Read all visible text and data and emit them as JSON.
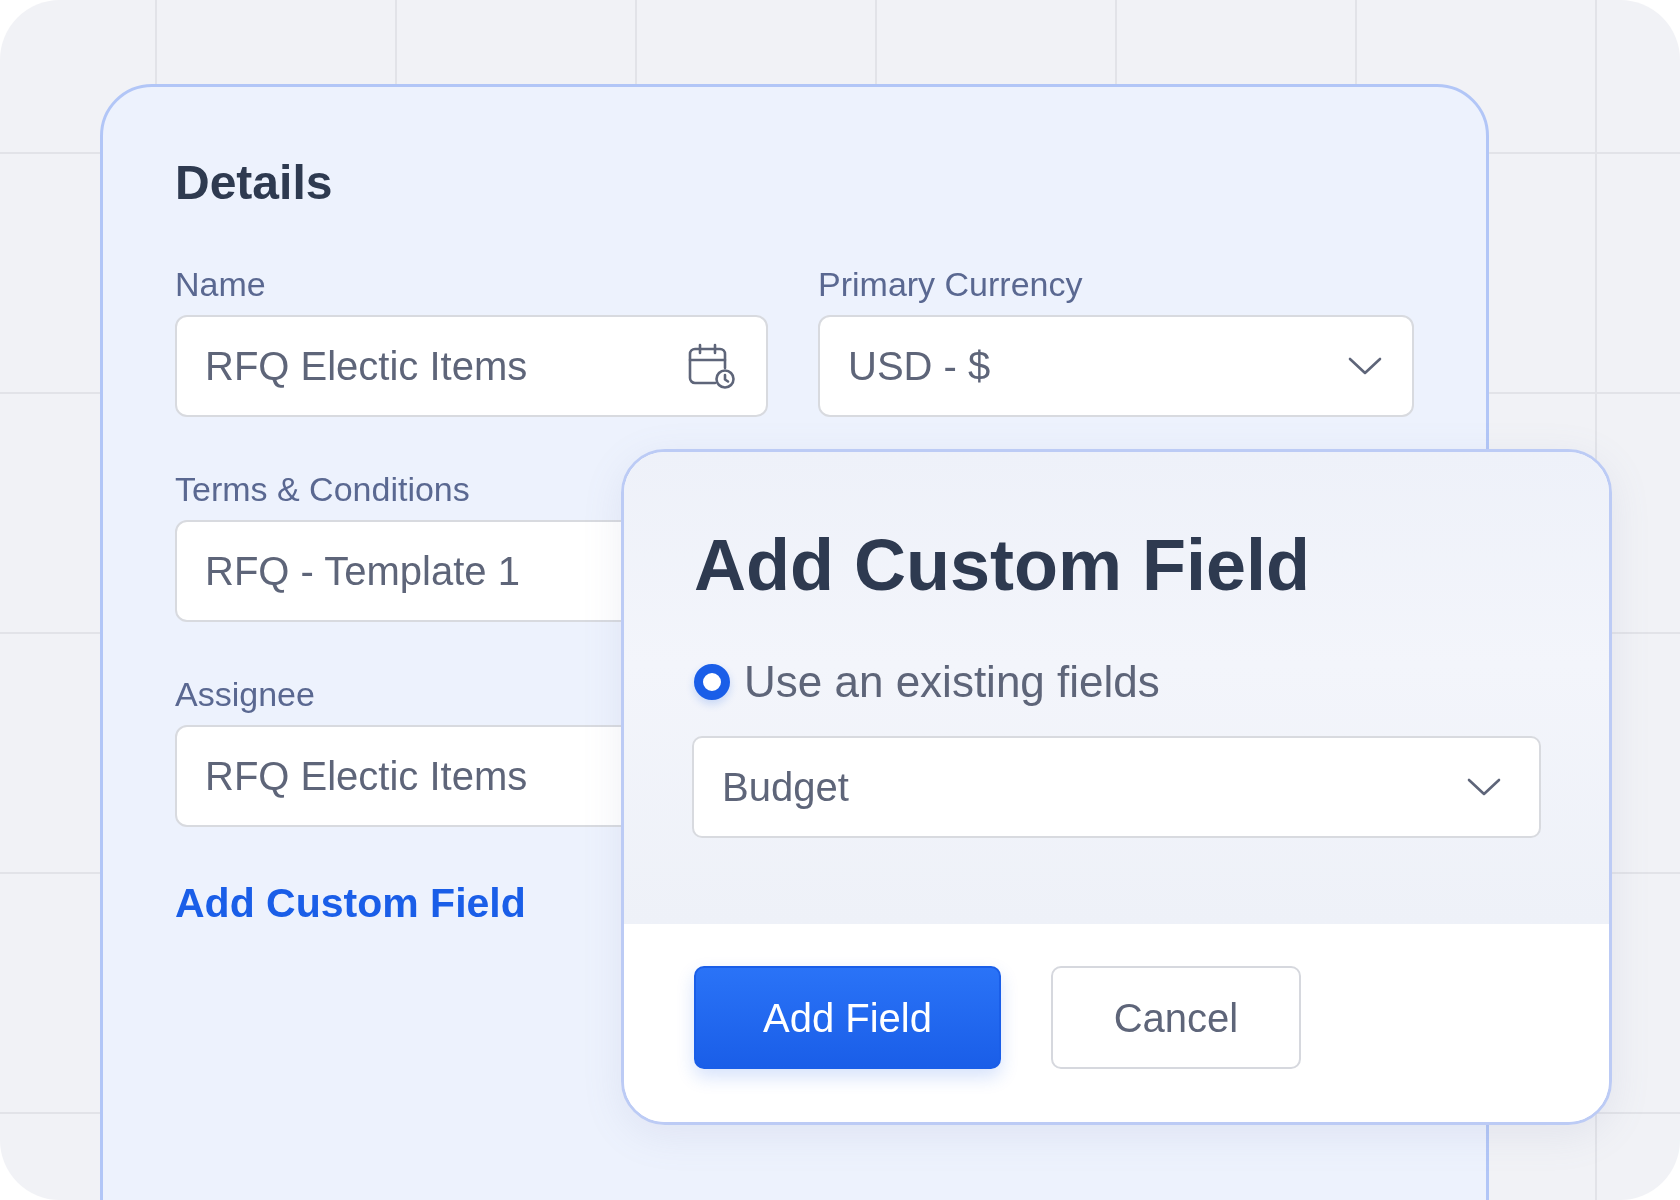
{
  "details": {
    "title": "Details",
    "fields": [
      {
        "label": "Name",
        "value": "RFQ Electic Items",
        "kind": "date"
      },
      {
        "label": "Primary Currency",
        "value": "USD - $",
        "kind": "select"
      },
      {
        "label": "Terms & Conditions",
        "value": "RFQ - Template 1",
        "kind": "text"
      },
      {
        "label": "Assignee",
        "value": "RFQ Electic Items",
        "kind": "text"
      }
    ],
    "add_link": "Add Custom Field"
  },
  "dialog": {
    "title": "Add Custom Field",
    "option": {
      "label": "Use an existing fields",
      "selected": true
    },
    "select": {
      "value": "Budget"
    },
    "buttons": [
      {
        "label": "Add Field",
        "kind": "primary"
      },
      {
        "label": "Cancel",
        "kind": "secondary"
      }
    ]
  }
}
